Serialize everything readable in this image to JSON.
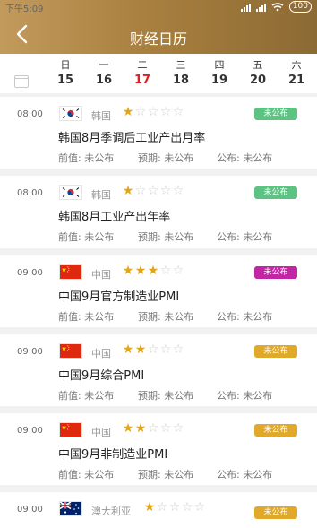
{
  "status": {
    "time": "下午5:09",
    "battery": "100"
  },
  "header": {
    "title": "财经日历"
  },
  "week": [
    {
      "w": "日",
      "d": "15"
    },
    {
      "w": "一",
      "d": "16"
    },
    {
      "w": "二",
      "d": "17",
      "today": true
    },
    {
      "w": "三",
      "d": "18"
    },
    {
      "w": "四",
      "d": "19"
    },
    {
      "w": "五",
      "d": "20"
    },
    {
      "w": "六",
      "d": "21"
    }
  ],
  "labels": {
    "prev": "前值: 未公布",
    "expect": "预期: 未公布",
    "actual": "公布: 未公布"
  },
  "colors": {
    "badge_green": "#5cc383",
    "badge_magenta": "#c326a5",
    "badge_gold": "#e0a92a"
  },
  "events": [
    {
      "time": "08:00",
      "flag": "kr",
      "country": "韩国",
      "stars": 1,
      "status": "未公布",
      "status_color": "#5cc383",
      "name": "韩国8月季调后工业产出月率"
    },
    {
      "time": "08:00",
      "flag": "kr",
      "country": "韩国",
      "stars": 1,
      "status": "未公布",
      "status_color": "#5cc383",
      "name": "韩国8月工业产出年率"
    },
    {
      "time": "09:00",
      "flag": "cn",
      "country": "中国",
      "stars": 3,
      "status": "未公布",
      "status_color": "#c326a5",
      "name": "中国9月官方制造业PMI"
    },
    {
      "time": "09:00",
      "flag": "cn",
      "country": "中国",
      "stars": 2,
      "status": "未公布",
      "status_color": "#e0a92a",
      "name": "中国9月综合PMI"
    },
    {
      "time": "09:00",
      "flag": "cn",
      "country": "中国",
      "stars": 2,
      "status": "未公布",
      "status_color": "#e0a92a",
      "name": "中国9月非制造业PMI"
    },
    {
      "time": "09:00",
      "flag": "au",
      "country": "澳大利亚",
      "stars": 1,
      "status": "未公布",
      "status_color": "#e0a92a",
      "name": ""
    }
  ]
}
